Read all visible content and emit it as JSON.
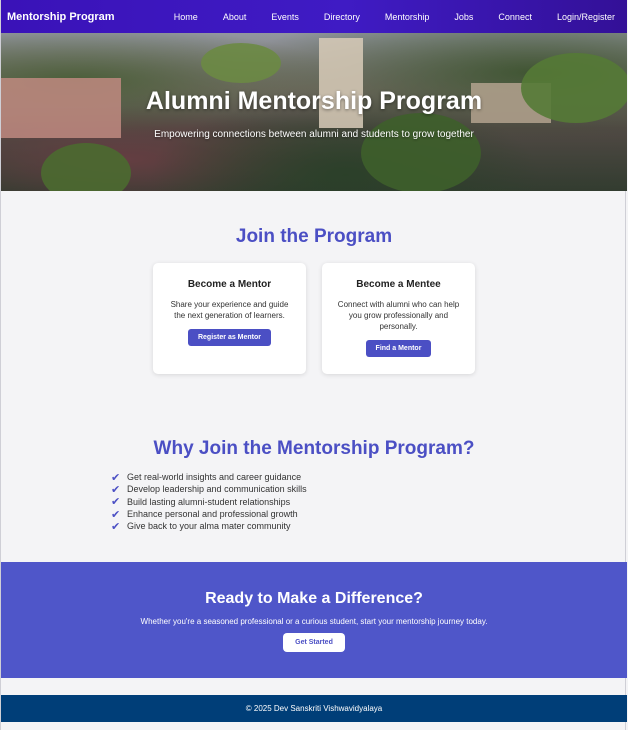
{
  "nav": {
    "brand": "Mentorship Program",
    "links": [
      "Home",
      "About",
      "Events",
      "Directory",
      "Mentorship",
      "Jobs",
      "Connect",
      "Login/Register"
    ]
  },
  "hero": {
    "title": "Alumni Mentorship Program",
    "subtitle": "Empowering connections between alumni and students to grow together"
  },
  "join": {
    "title": "Join the Program",
    "cards": [
      {
        "title": "Become a Mentor",
        "text": "Share your experience and guide the next generation of learners.",
        "button": "Register as Mentor"
      },
      {
        "title": "Become a Mentee",
        "text": "Connect with alumni who can help you grow professionally and personally.",
        "button": "Find a Mentor"
      }
    ]
  },
  "why": {
    "title": "Why Join the Mentorship Program?",
    "items": [
      "Get real-world insights and career guidance",
      "Develop leadership and communication skills",
      "Build lasting alumni-student relationships",
      "Enhance personal and professional growth",
      "Give back to your alma mater community"
    ]
  },
  "cta": {
    "title": "Ready to Make a Difference?",
    "text": "Whether you're a seasoned professional or a curious student, start your mentorship journey today.",
    "button": "Get Started"
  },
  "footer": {
    "text": "© 2025 Dev Sanskriti Vishwavidyalaya"
  },
  "colors": {
    "nav": "#3a12b8",
    "accent": "#4b4fc4",
    "cta_bg": "#4f56c9",
    "footer_bg": "#003e78"
  }
}
